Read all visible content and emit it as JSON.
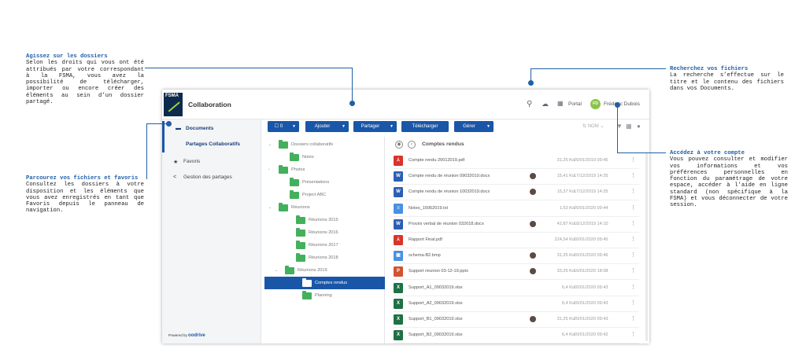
{
  "annotations": {
    "left_top": {
      "title": "Agissez sur les dossiers",
      "body": "Selon les droits qui vous ont été attribués par votre correspondant à la FSMA, vous avez la possibilité de télécharger, importer ou encore créer des éléments au sein d’un dossier partagé."
    },
    "left_mid": {
      "title": "Parcourez vos fichiers et favoris",
      "body": "Consultez les dossiers à votre disposition et les éléments que vous avez enregistrés en tant que Favoris depuis le panneau de navigation."
    },
    "right_top": {
      "title": "Recherchez vos fichiers",
      "body": "La recherche s’effectue sur le titre et le contenu des fichiers dans vos Documents."
    },
    "right_mid": {
      "title": "Accédez à votre compte",
      "body": "Vous pouvez consulter et modifier vos informations et vos préférences personnelles en fonction du paramétrage de votre espace, accéder à l’aide en ligne standard (non spécifique à la FSMA) et vous déconnecter de votre session."
    }
  },
  "app": {
    "logo_text": "FSMA",
    "title": "Collaboration",
    "portal_label": "Portal",
    "user_initials": "FD",
    "user_name": "Frédéric Dubois",
    "accent_color": "#1a56a8",
    "folder_color": "#43b05c"
  },
  "sidebar": {
    "items": [
      {
        "label": "Documents",
        "icon": "folder-icon"
      },
      {
        "label": "Partages Collaboratifs",
        "icon": ""
      },
      {
        "label": "Favoris",
        "icon": "star-icon"
      },
      {
        "label": "Gestion des partages",
        "icon": "share-icon"
      }
    ],
    "powered_by": "Powered by",
    "brand": "oodrive"
  },
  "toolbar": {
    "select_count": "0",
    "buttons": [
      "Ajouter",
      "Partager",
      "Télécharger",
      "Gérer"
    ],
    "sort_label": "NOM"
  },
  "tree": [
    {
      "label": "Dossiers collaboratifs",
      "chev": "⌄"
    },
    {
      "label": "Notes",
      "chev": ""
    },
    {
      "label": "Photos",
      "chev": "›"
    },
    {
      "label": "Présentations",
      "chev": ""
    },
    {
      "label": "Project ABC",
      "chev": ""
    },
    {
      "label": "Réunions",
      "chev": "⌄"
    },
    {
      "label": "Réunions 2015",
      "chev": ""
    },
    {
      "label": "Réunions 2016",
      "chev": ""
    },
    {
      "label": "Réunions 2017",
      "chev": ""
    },
    {
      "label": "Réunions 2018",
      "chev": ""
    },
    {
      "label": "Réunions 2019",
      "chev": "⌄"
    },
    {
      "label": "Comptes rendus",
      "chev": ""
    },
    {
      "label": "Planning",
      "chev": ""
    }
  ],
  "files_header": {
    "title": "Comptes rendus"
  },
  "files": [
    {
      "name": "Compte rendu 20012019.pdf",
      "type": "pdf",
      "size": "31,25 Ko",
      "date": "20/01/2019 09:45",
      "shared": false
    },
    {
      "name": "Compte rendu de réunion 09032019.docx",
      "type": "word",
      "size": "15,41 Ko",
      "date": "17/12/2019 14:25",
      "shared": true
    },
    {
      "name": "Compte rendu de réunion 10032019.docx",
      "type": "word",
      "size": "15,37 Ko",
      "date": "17/12/2019 14:25",
      "shared": true
    },
    {
      "name": "Notes_15062019.txt",
      "type": "txt",
      "size": "1,53 Ko",
      "date": "20/01/2020 09:44",
      "shared": false
    },
    {
      "name": "Procès verbal de réunion 032018.docx",
      "type": "word",
      "size": "42,87 Ko",
      "date": "18/12/2019 14:10",
      "shared": true
    },
    {
      "name": "Rapport Final.pdf",
      "type": "pdf",
      "size": "224,54 Ko",
      "date": "20/01/2020 09:45",
      "shared": false
    },
    {
      "name": "schema-B2.bmp",
      "type": "img",
      "size": "31,25 Ko",
      "date": "20/01/2020 09:46",
      "shared": true
    },
    {
      "name": "Support réunion 03-12-19.pptx",
      "type": "ppt",
      "size": "33,25 Ko",
      "date": "16/01/2020 18:08",
      "shared": true
    },
    {
      "name": "Support_A1_09032019.xlsx",
      "type": "excel",
      "size": "6,4 Ko",
      "date": "20/01/2020 09:43",
      "shared": false
    },
    {
      "name": "Support_A2_09032019.xlsx",
      "type": "excel",
      "size": "6,4 Ko",
      "date": "20/01/2020 09:43",
      "shared": false
    },
    {
      "name": "Support_B1_09032019.xlsx",
      "type": "excel",
      "size": "31,25 Ko",
      "date": "20/01/2020 09:43",
      "shared": true
    },
    {
      "name": "Support_B2_09032019.xlsx",
      "type": "excel",
      "size": "6,4 Ko",
      "date": "20/01/2020 09:42",
      "shared": false
    }
  ],
  "file_type_colors": {
    "pdf": "#d9342b",
    "word": "#2b5fb3",
    "txt": "#4a90e2",
    "img": "#4a90e2",
    "ppt": "#d35230",
    "excel": "#1e7145"
  }
}
